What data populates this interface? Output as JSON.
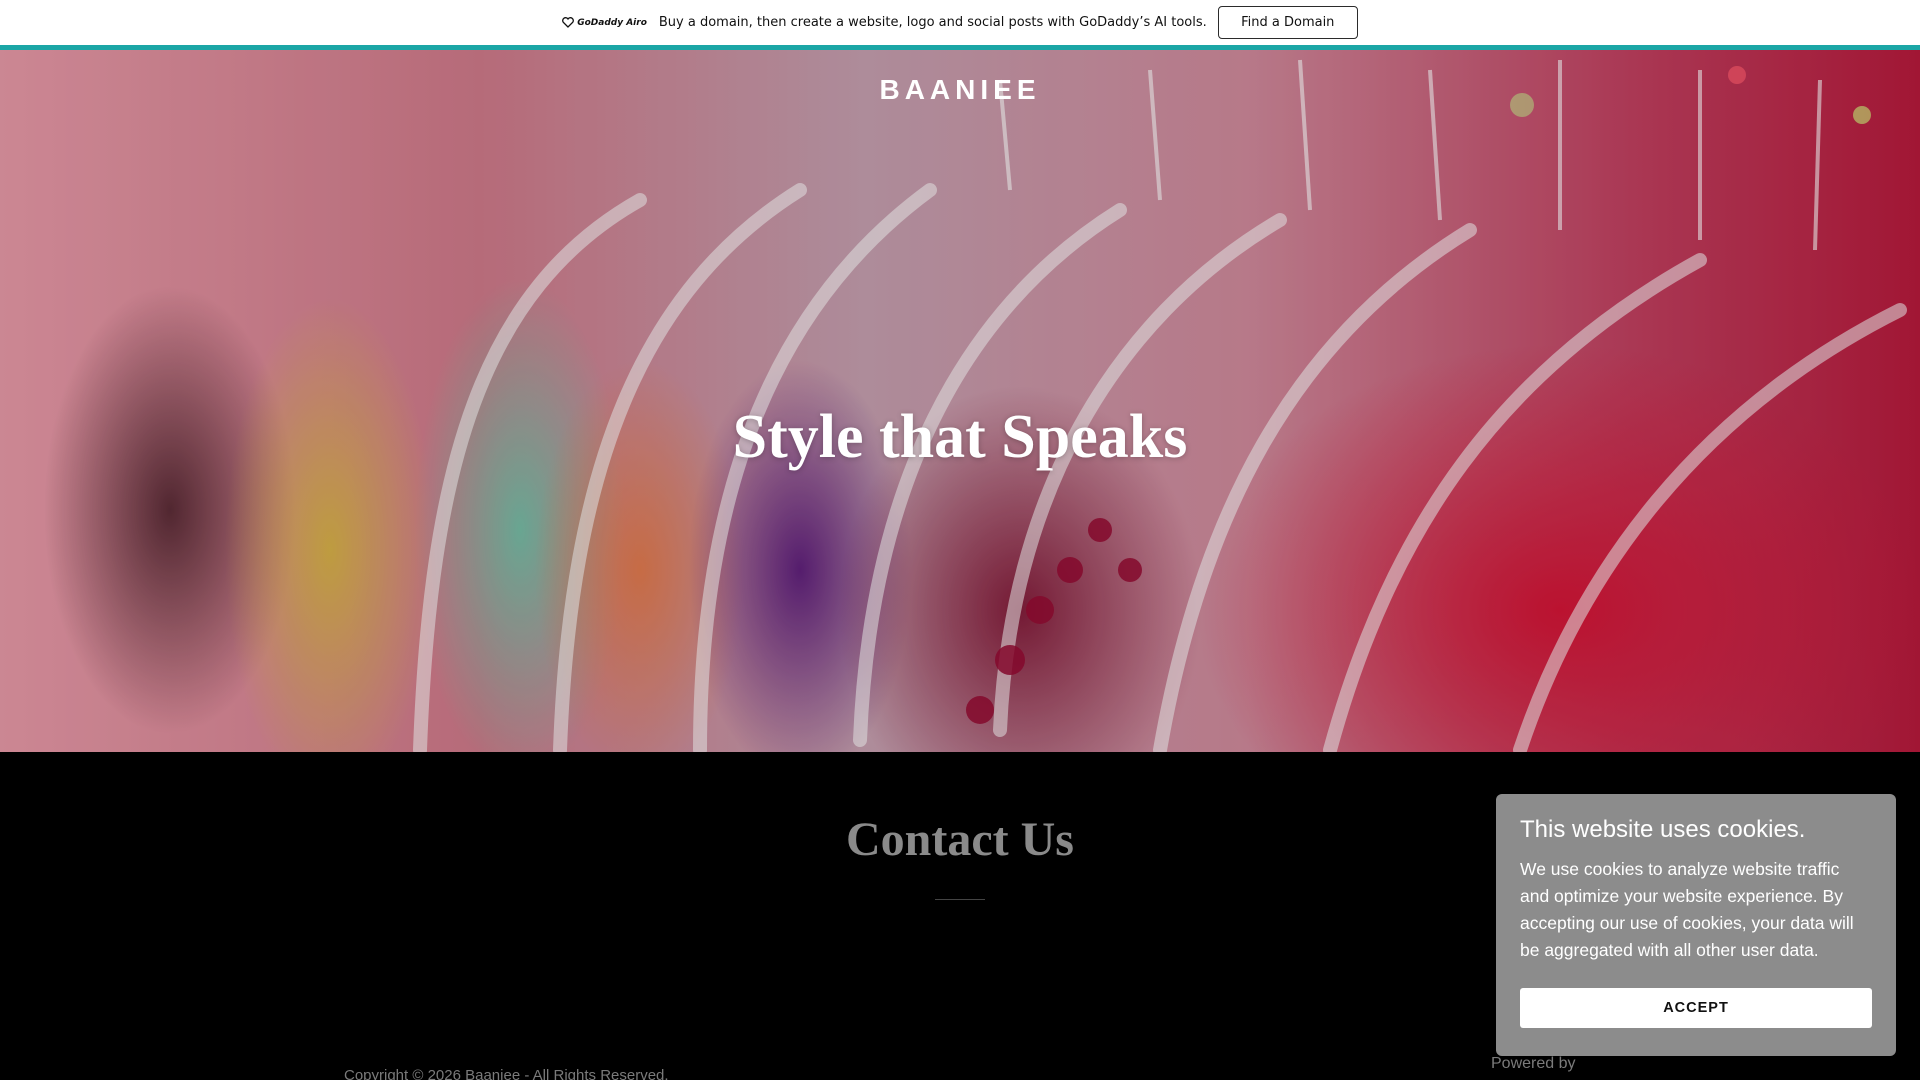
{
  "promo": {
    "logo_text": "GoDaddy Airo",
    "logo_icon": "godaddy-heart-icon",
    "message": "Buy a domain, then create a website, logo and social posts with GoDaddy’s AI tools.",
    "button_label": "Find a Domain"
  },
  "hero": {
    "brand": "BAANIEE",
    "title": "Style that Speaks"
  },
  "contact": {
    "title": "Contact Us"
  },
  "footer": {
    "copyright": "Copyright © 2026 Baaniee - All Rights Reserved.",
    "powered_by": "Powered by"
  },
  "cookie_banner": {
    "title": "This website uses cookies.",
    "text": "We use cookies to analyze website traffic and optimize your website experience. By accepting our use of cookies, your data will be aggregated with all other user data.",
    "accept_label": "ACCEPT"
  },
  "colors": {
    "accent_line": "#1ba6a6",
    "page_background": "#000000",
    "cookie_background": "#8c8c8c"
  }
}
